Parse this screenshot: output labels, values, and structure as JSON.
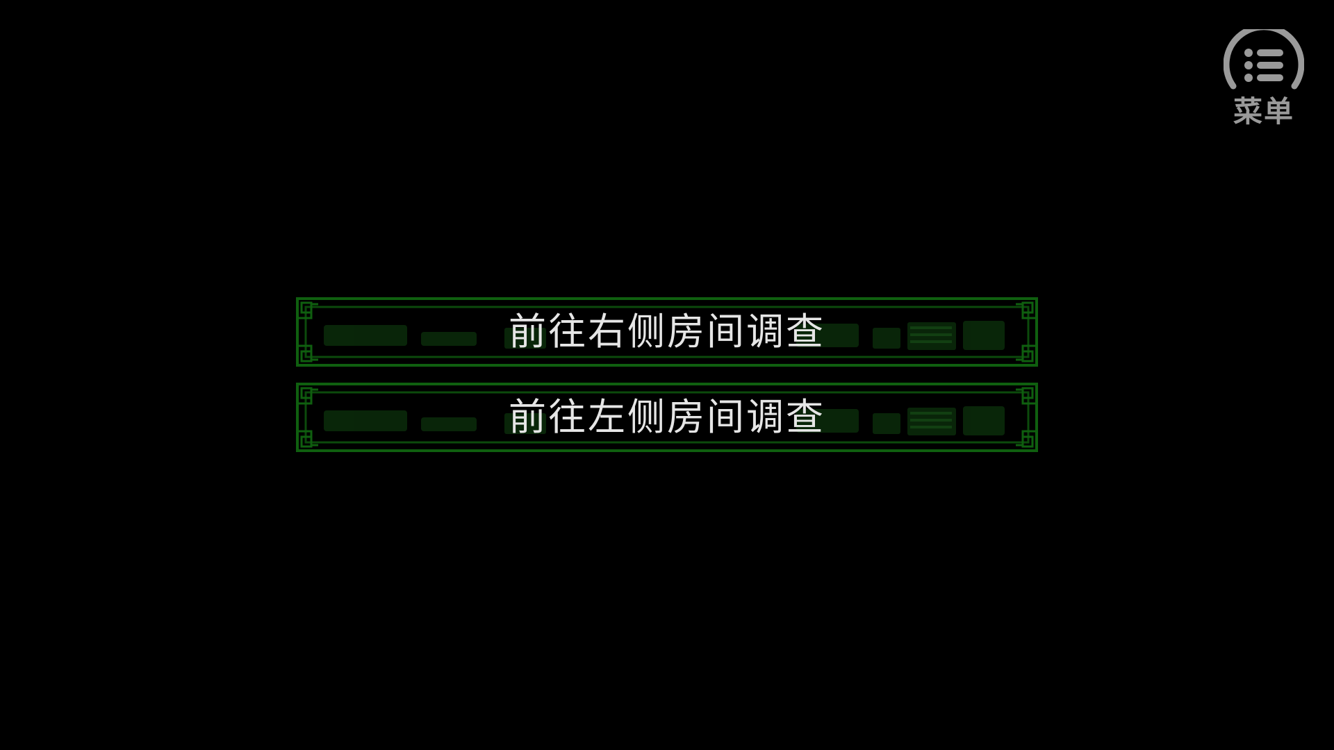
{
  "menu": {
    "label": "菜单",
    "icon": "list-menu-icon",
    "color": "#9a9a9a"
  },
  "choices": [
    {
      "label": "前往右侧房间调查"
    },
    {
      "label": "前往左侧房间调查"
    }
  ],
  "colors": {
    "background": "#000000",
    "frame_green": "#0f5f0f",
    "text": "#e6e6e6"
  }
}
